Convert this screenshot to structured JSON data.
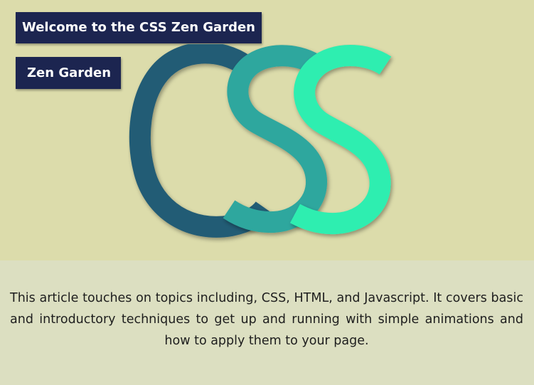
{
  "header": {
    "title": "Welcome to the CSS Zen Garden",
    "subtitle": "Zen Garden"
  },
  "logo": {
    "name": "css-logo",
    "letters": [
      "C",
      "S",
      "S"
    ],
    "colors": [
      "#235c74",
      "#2ea79e",
      "#2eeeb0"
    ]
  },
  "description": {
    "text": "This article touches on topics including, CSS, HTML, and Javascript. It covers basic and introductory techniques to get up and running with simple animations and how to apply them to your page."
  },
  "colors": {
    "hero_background": "#dcdcab",
    "description_background": "#dcdfc1",
    "badge_background": "#1c2550",
    "badge_text": "#ffffff"
  }
}
